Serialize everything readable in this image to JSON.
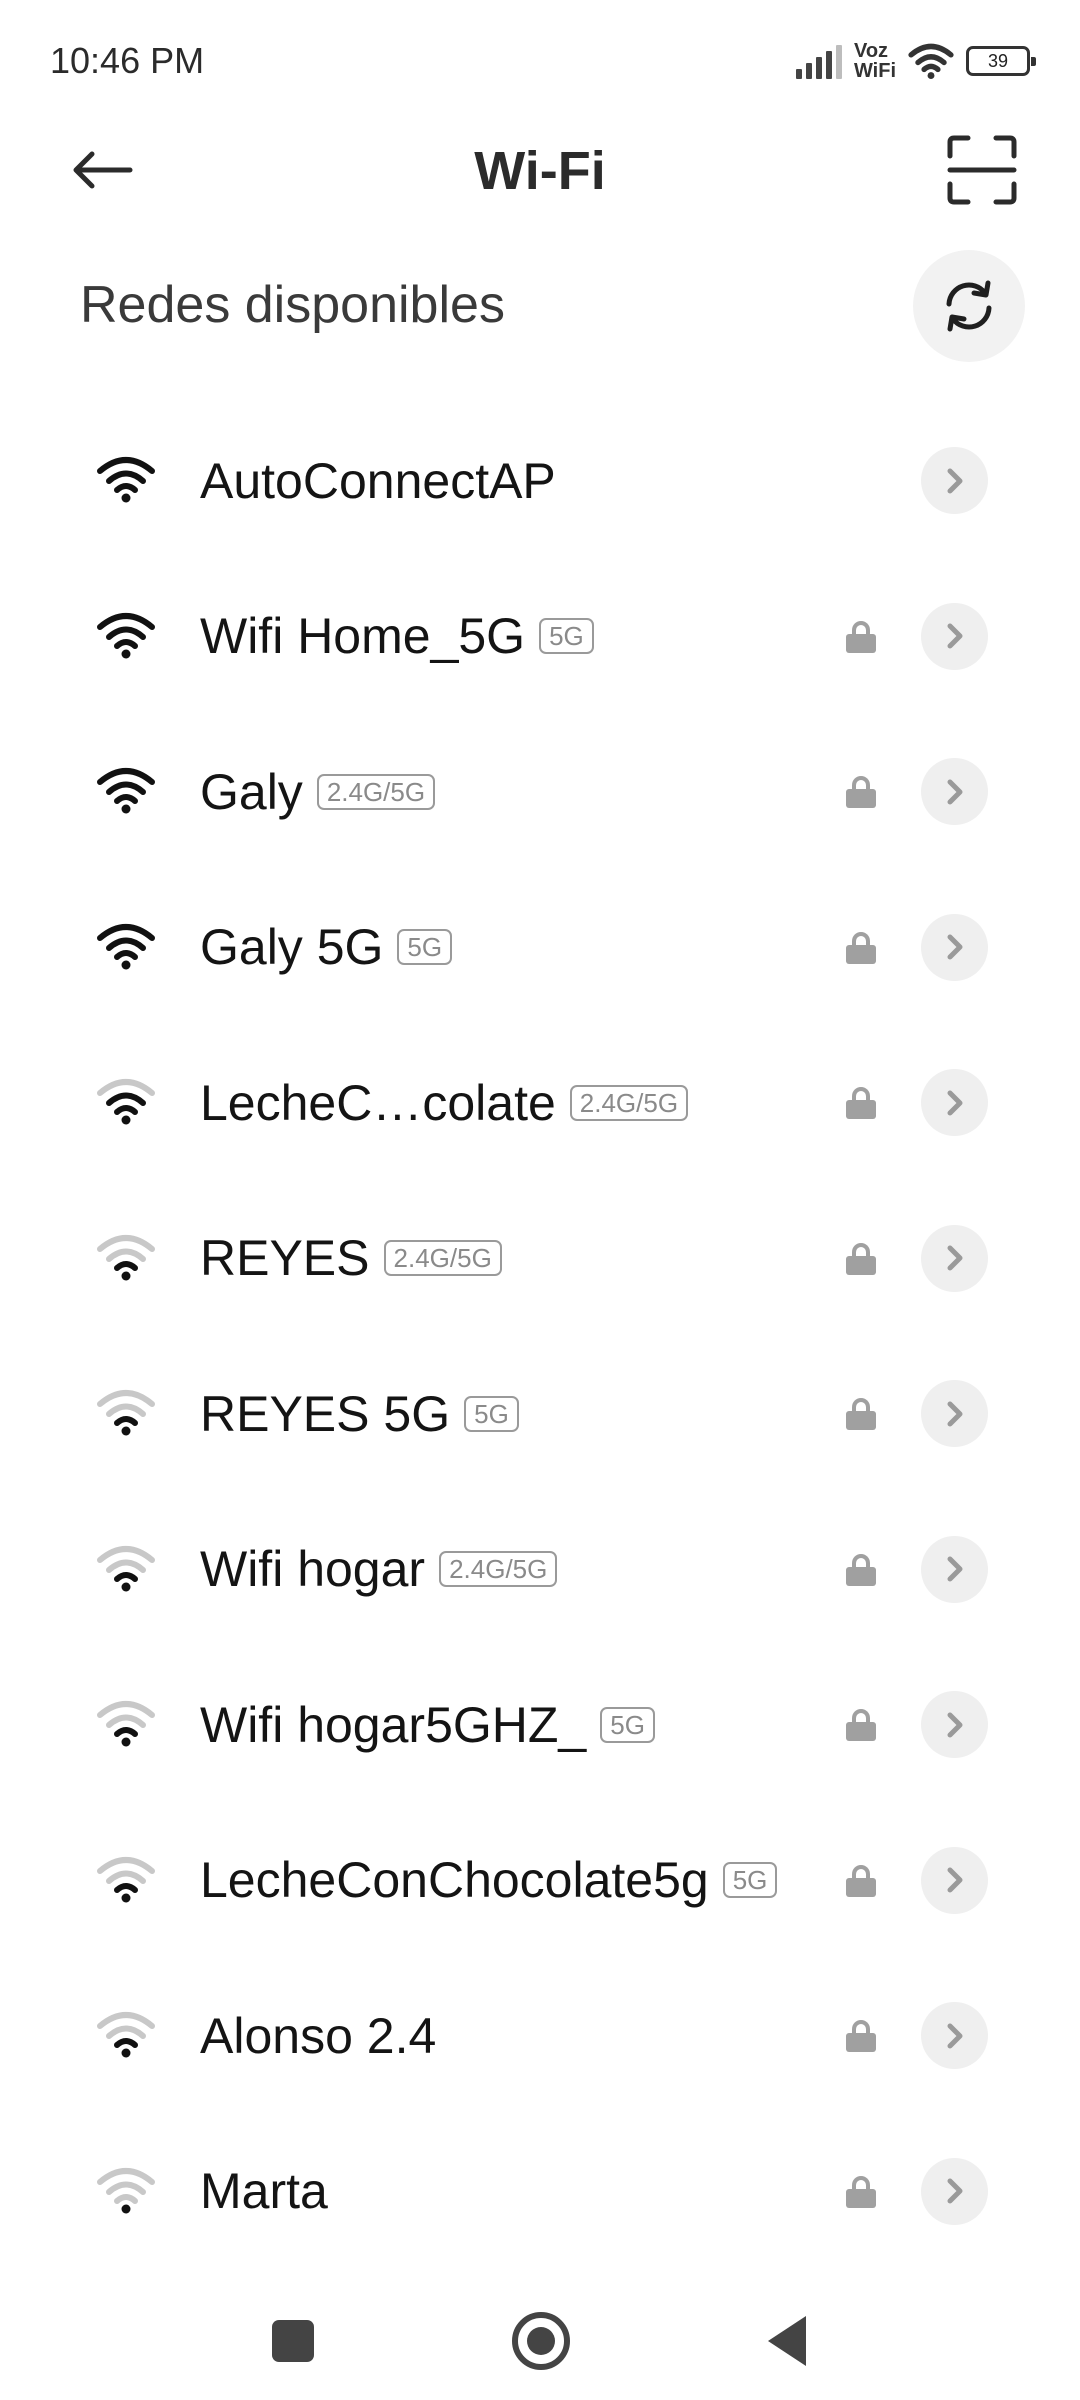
{
  "status_bar": {
    "time": "10:46 PM",
    "voz_line1": "Voz",
    "voz_line2": "WiFi",
    "battery": "39"
  },
  "header": {
    "title": "Wi-Fi",
    "back_icon": "arrow-left-icon",
    "scan_icon": "qr-scan-icon"
  },
  "section": {
    "title": "Redes disponibles",
    "refresh_icon": "refresh-icon"
  },
  "networks": [
    {
      "name": "AutoConnectAP",
      "band": "",
      "secured": false,
      "signal": 4
    },
    {
      "name": "Wifi Home_5G",
      "band": "5G",
      "secured": true,
      "signal": 4
    },
    {
      "name": "Galy",
      "band": "2.4G/5G",
      "secured": true,
      "signal": 4
    },
    {
      "name": "Galy 5G",
      "band": "5G",
      "secured": true,
      "signal": 4
    },
    {
      "name": "LecheC…colate",
      "band": "2.4G/5G",
      "secured": true,
      "signal": 3
    },
    {
      "name": "REYES",
      "band": "2.4G/5G",
      "secured": true,
      "signal": 2
    },
    {
      "name": "REYES 5G",
      "band": "5G",
      "secured": true,
      "signal": 2
    },
    {
      "name": "Wifi hogar",
      "band": "2.4G/5G",
      "secured": true,
      "signal": 2
    },
    {
      "name": "Wifi hogar5GHZ_",
      "band": "5G",
      "secured": true,
      "signal": 2
    },
    {
      "name": "LecheConChocolate5g",
      "band": "5G",
      "secured": true,
      "signal": 2
    },
    {
      "name": "Alonso 2.4",
      "band": "",
      "secured": true,
      "signal": 2
    },
    {
      "name": "Marta",
      "band": "",
      "secured": true,
      "signal": 1
    }
  ],
  "colors": {
    "active_arc": "#111111",
    "inactive_arc": "#c8c8c8",
    "lock": "#a0a0a0",
    "arrow": "#9a9a9a"
  }
}
